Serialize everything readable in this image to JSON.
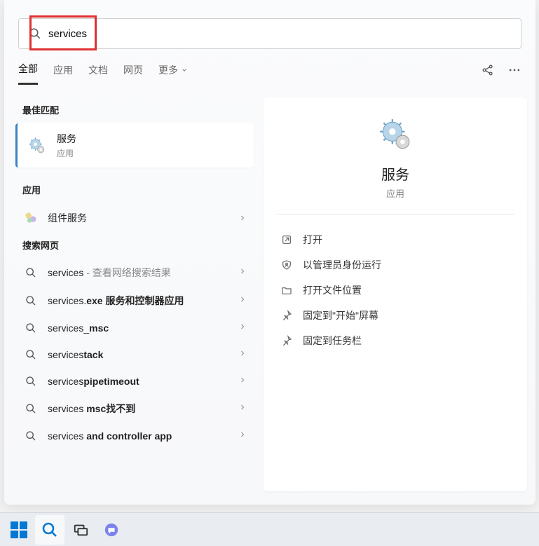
{
  "search": {
    "value": "services",
    "placeholder": ""
  },
  "tabs": {
    "all": "全部",
    "apps": "应用",
    "docs": "文档",
    "web": "网页",
    "more": "更多"
  },
  "sections": {
    "best_match": "最佳匹配",
    "apps": "应用",
    "web": "搜索网页"
  },
  "best": {
    "title": "服务",
    "sub": "应用"
  },
  "apps_list": [
    {
      "title": "组件服务"
    }
  ],
  "web_list": [
    {
      "prefix": "services",
      "suffix": " - 查看网络搜索结果",
      "prefix_bold": false,
      "suffix_muted": true
    },
    {
      "prefix": "services.",
      "suffix": "exe 服务和控制器应用",
      "prefix_bold": false,
      "suffix_bold": true
    },
    {
      "prefix": "services_",
      "suffix": "msc",
      "suffix_bold": true
    },
    {
      "prefix": "services",
      "suffix": "tack",
      "suffix_bold": true
    },
    {
      "prefix": "services",
      "suffix": "pipetimeout",
      "suffix_bold": true
    },
    {
      "prefix": "services ",
      "suffix": "msc找不到",
      "suffix_bold": true
    },
    {
      "prefix": "services ",
      "suffix": "and controller app",
      "suffix_bold": true
    }
  ],
  "preview": {
    "title": "服务",
    "sub": "应用",
    "actions": {
      "open": "打开",
      "admin": "以管理员身份运行",
      "location": "打开文件位置",
      "pin_start": "固定到\"开始\"屏幕",
      "pin_taskbar": "固定到任务栏"
    }
  }
}
